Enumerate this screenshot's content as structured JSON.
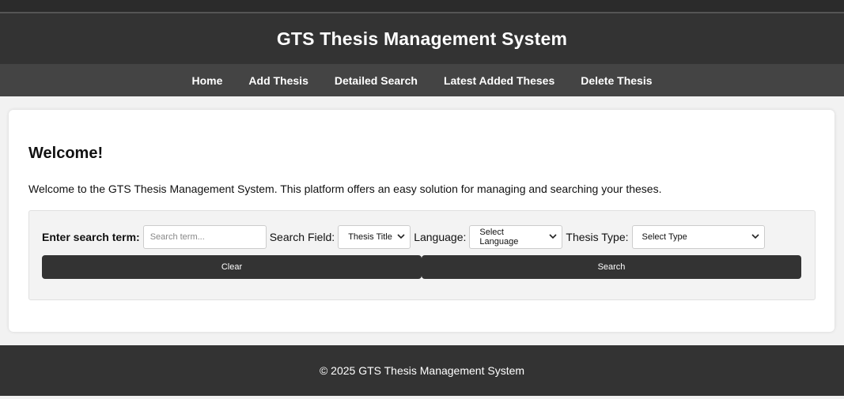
{
  "header": {
    "title": "GTS Thesis Management System"
  },
  "nav": {
    "items": [
      {
        "label": "Home"
      },
      {
        "label": "Add Thesis"
      },
      {
        "label": "Detailed Search"
      },
      {
        "label": "Latest Added Theses"
      },
      {
        "label": "Delete Thesis"
      }
    ]
  },
  "main": {
    "heading": "Welcome!",
    "intro": "Welcome to the GTS Thesis Management System. This platform offers an easy solution for managing and searching your theses."
  },
  "search": {
    "term_label": "Enter search term:",
    "term_placeholder": "Search term...",
    "term_value": "",
    "field_label": "Search Field:",
    "field_selected": "Thesis Title",
    "language_label": "Language:",
    "language_selected": "Select Language",
    "type_label": "Thesis Type:",
    "type_selected": "Select Type",
    "clear_label": "Clear",
    "search_label": "Search"
  },
  "footer": {
    "text": "© 2025 GTS Thesis Management System"
  },
  "icons": {
    "select_arrow": "chevron-down-icon"
  },
  "colors": {
    "header_bg": "#333333",
    "nav_bg": "#444444",
    "button_bg": "#333333"
  }
}
